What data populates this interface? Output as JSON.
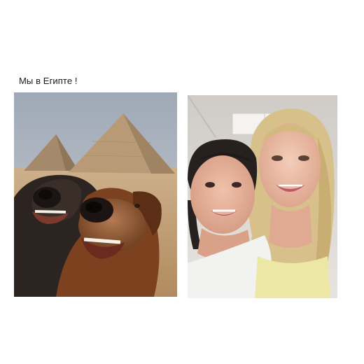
{
  "post": {
    "caption": "Мы в Египте !"
  },
  "images": [
    {
      "name": "dogs-pyramids-selfie",
      "colors": {
        "sky": "#aeb7c3",
        "sand": "#c9a97e",
        "pyramid": "#b79a74",
        "dog_dark": "#2e2420",
        "dog_brown": "#8a4a22"
      }
    },
    {
      "name": "women-selfie",
      "colors": {
        "ceiling": "#d9d6d2",
        "hair_dark": "#2a2426",
        "hair_blonde": "#d9c28a",
        "skin": "#e9b9a3",
        "top": "#efe7a4"
      }
    }
  ]
}
